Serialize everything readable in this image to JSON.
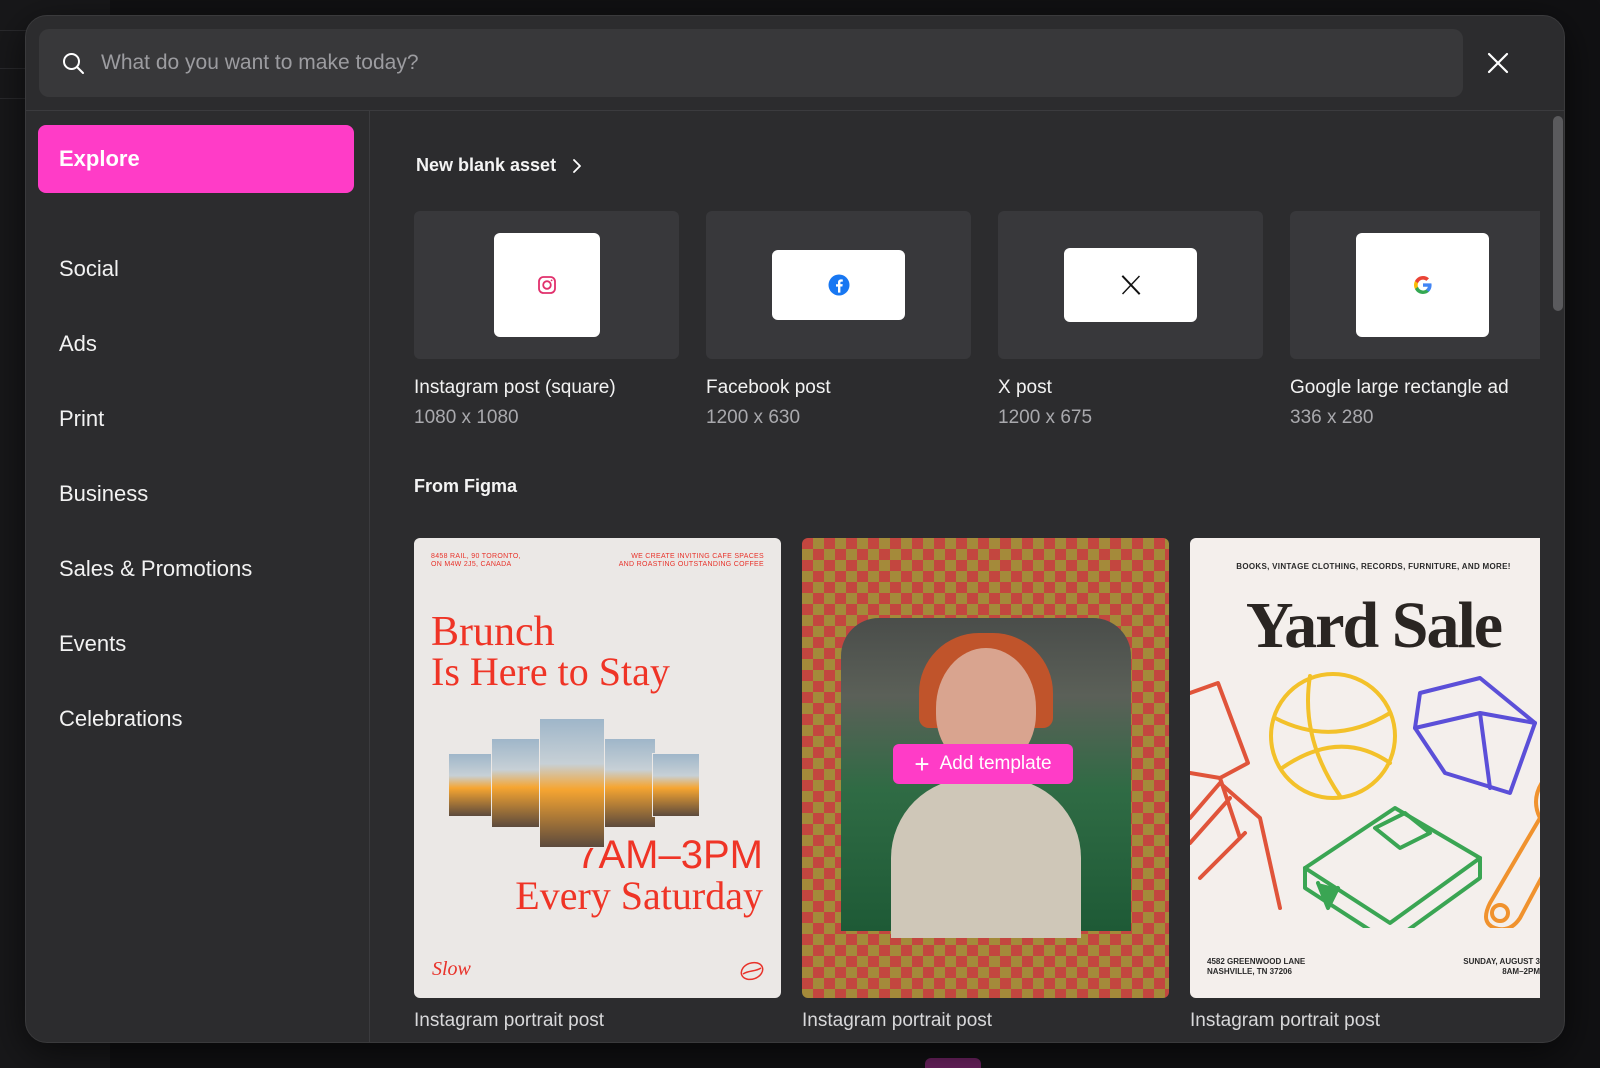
{
  "search": {
    "placeholder": "What do you want to make today?"
  },
  "sidebar": {
    "explore_label": "Explore",
    "items": [
      {
        "label": "Social"
      },
      {
        "label": "Ads"
      },
      {
        "label": "Print"
      },
      {
        "label": "Business"
      },
      {
        "label": "Sales & Promotions"
      },
      {
        "label": "Events"
      },
      {
        "label": "Celebrations"
      }
    ]
  },
  "blank_section": {
    "title": "New blank asset",
    "items": [
      {
        "title": "Instagram post (square)",
        "size": "1080 x 1080",
        "icon": "instagram-icon"
      },
      {
        "title": "Facebook post",
        "size": "1200 x 630",
        "icon": "facebook-icon"
      },
      {
        "title": "X post",
        "size": "1200 x 675",
        "icon": "x-icon"
      },
      {
        "title": "Google large rectangle ad",
        "size": "336 x 280",
        "icon": "google-icon"
      }
    ]
  },
  "templates_section": {
    "title": "From Figma",
    "add_template_label": "Add template",
    "items": [
      {
        "title": "Instagram portrait post",
        "poster": {
          "top_left": "8458 RAIL, 90 TORONTO,\nON M4W 2J5, CANADA",
          "top_right": "WE CREATE INVITING CAFE SPACES\nAND ROASTING OUTSTANDING COFFEE",
          "line1": "Brunch",
          "line2": "Is Here to Stay",
          "line3": "7AM–3PM",
          "line4": "Every Saturday",
          "brand": "Slow"
        }
      },
      {
        "title": "Instagram portrait post"
      },
      {
        "title": "Instagram portrait post",
        "poster": {
          "tagline": "BOOKS, VINTAGE CLOTHING, RECORDS, FURNITURE, AND MORE!",
          "headline": "Yard Sale",
          "address": "4582 GREENWOOD LANE\nNASHVILLE, TN 37206",
          "date": "SUNDAY, AUGUST 3\n8AM–2PM"
        }
      }
    ]
  },
  "colors": {
    "accent": "#ff3cc7",
    "modal_bg": "#2c2c2e",
    "search_bg": "#38383a"
  }
}
